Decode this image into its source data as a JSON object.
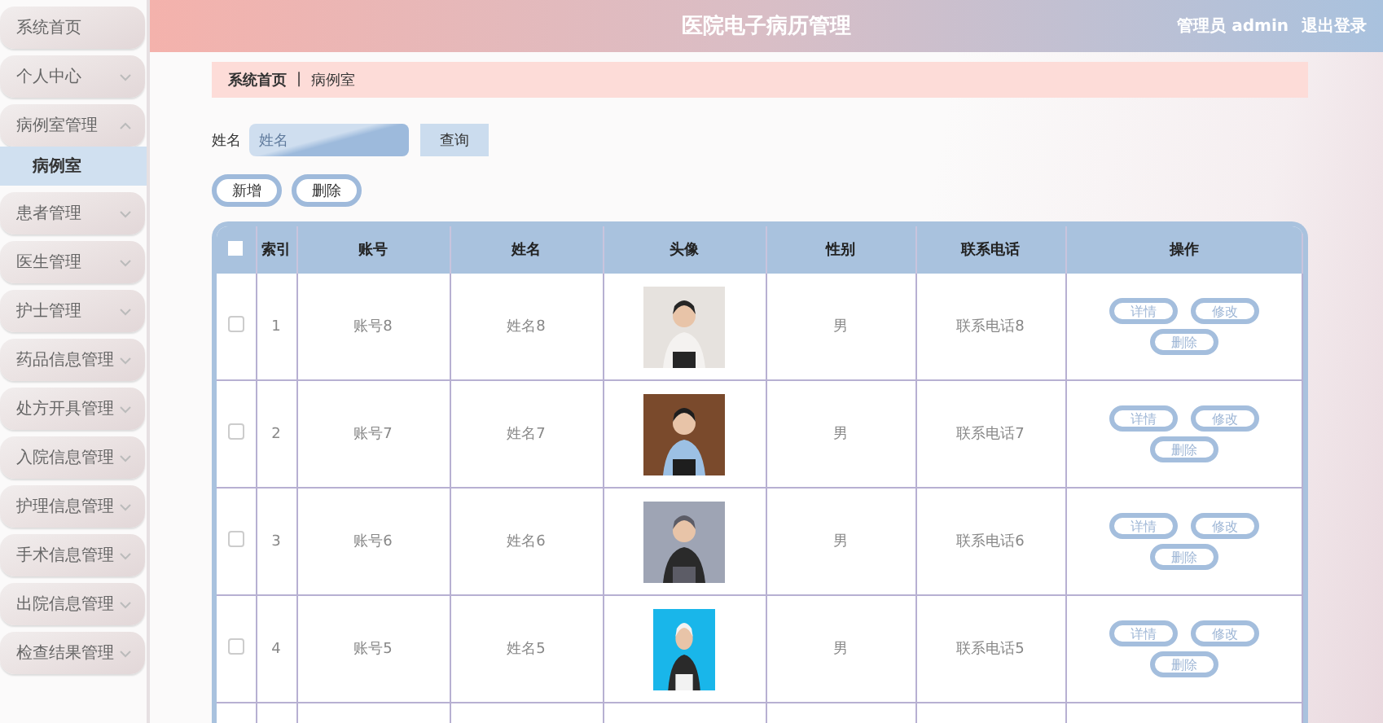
{
  "header": {
    "title": "医院电子病历管理",
    "user": "管理员 admin",
    "logout": "退出登录"
  },
  "sidebar": {
    "items": [
      {
        "label": "系统首页",
        "kind": "link"
      },
      {
        "label": "个人中心",
        "kind": "menu",
        "expanded": false
      },
      {
        "label": "病例室管理",
        "kind": "menu",
        "expanded": true,
        "children": [
          {
            "label": "病例室",
            "selected": true
          }
        ]
      },
      {
        "label": "患者管理",
        "kind": "menu",
        "expanded": false
      },
      {
        "label": "医生管理",
        "kind": "menu",
        "expanded": false
      },
      {
        "label": "护士管理",
        "kind": "menu",
        "expanded": false
      },
      {
        "label": "药品信息管理",
        "kind": "menu",
        "expanded": false
      },
      {
        "label": "处方开具管理",
        "kind": "menu",
        "expanded": false
      },
      {
        "label": "入院信息管理",
        "kind": "menu",
        "expanded": false
      },
      {
        "label": "护理信息管理",
        "kind": "menu",
        "expanded": false
      },
      {
        "label": "手术信息管理",
        "kind": "menu",
        "expanded": false
      },
      {
        "label": "出院信息管理",
        "kind": "menu",
        "expanded": false
      },
      {
        "label": "检查结果管理",
        "kind": "menu",
        "expanded": false
      }
    ]
  },
  "breadcrumb": {
    "items": [
      "系统首页",
      "病例室"
    ],
    "separator": "|"
  },
  "search": {
    "label": "姓名",
    "placeholder": "姓名",
    "button": "查询"
  },
  "actions": [
    "新增",
    "删除"
  ],
  "table": {
    "all_checked": false,
    "columns": [
      "索引",
      "账号",
      "姓名",
      "头像",
      "性别",
      "联系电话",
      "操作"
    ],
    "rows": [
      {
        "checked": false,
        "index": "1",
        "account": "账号8",
        "name": "姓名8",
        "avatar": {
          "kind": "picture"
        },
        "gender": "男",
        "phone": "联系电话8",
        "buttons": [
          "详情",
          "修改",
          "删除"
        ]
      },
      {
        "checked": false,
        "index": "2",
        "account": "账号7",
        "name": "姓名7",
        "avatar": {
          "kind": "picture"
        },
        "gender": "男",
        "phone": "联系电话7",
        "buttons": [
          "详情",
          "修改",
          "删除"
        ]
      },
      {
        "checked": false,
        "index": "3",
        "account": "账号6",
        "name": "姓名6",
        "avatar": {
          "kind": "picture"
        },
        "gender": "男",
        "phone": "联系电话6",
        "buttons": [
          "详情",
          "修改",
          "删除"
        ]
      },
      {
        "checked": false,
        "index": "4",
        "account": "账号5",
        "name": "姓名5",
        "avatar": {
          "kind": "picture"
        },
        "gender": "男",
        "phone": "联系电话5",
        "buttons": [
          "详情",
          "修改",
          "删除"
        ]
      }
    ]
  }
}
